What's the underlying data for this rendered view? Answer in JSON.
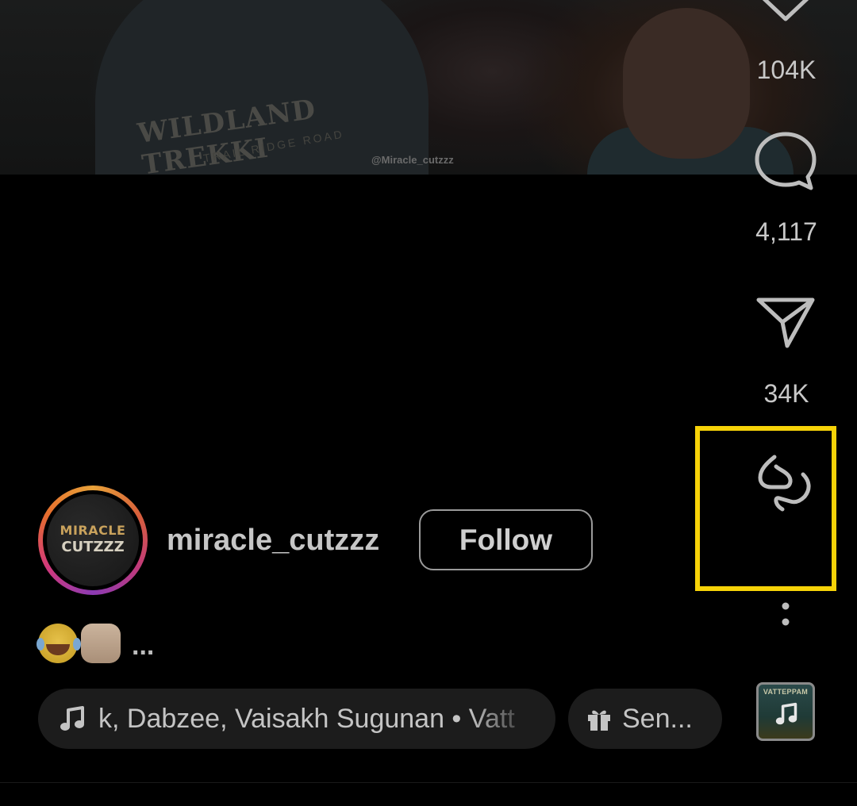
{
  "video": {
    "watermark": "@Miracle_cutzzz",
    "shirt_text": "WILDLAND TREKKI",
    "shirt_subtext": "TRAIL RIDGE ROAD"
  },
  "actions": {
    "like_count": "104K",
    "comment_count": "4,117",
    "share_count": "34K"
  },
  "author": {
    "avatar_text_1": "MIRACLE",
    "avatar_text_2": "CUTZZZ",
    "username": "miracle_cutzzz",
    "follow_label": "Follow"
  },
  "caption": {
    "more": "..."
  },
  "music": {
    "text": "k, Dabzee, Vaisakh Sugunan • Vatt"
  },
  "gift": {
    "label": "Sen..."
  },
  "album": {
    "title": "VATTEPPAM"
  },
  "colors": {
    "highlight": "#f7d308",
    "background": "#000000"
  },
  "icons": [
    "heart-icon",
    "comment-icon",
    "share-icon",
    "remix-icon",
    "more-options-icon",
    "music-note-icon",
    "gift-icon"
  ]
}
